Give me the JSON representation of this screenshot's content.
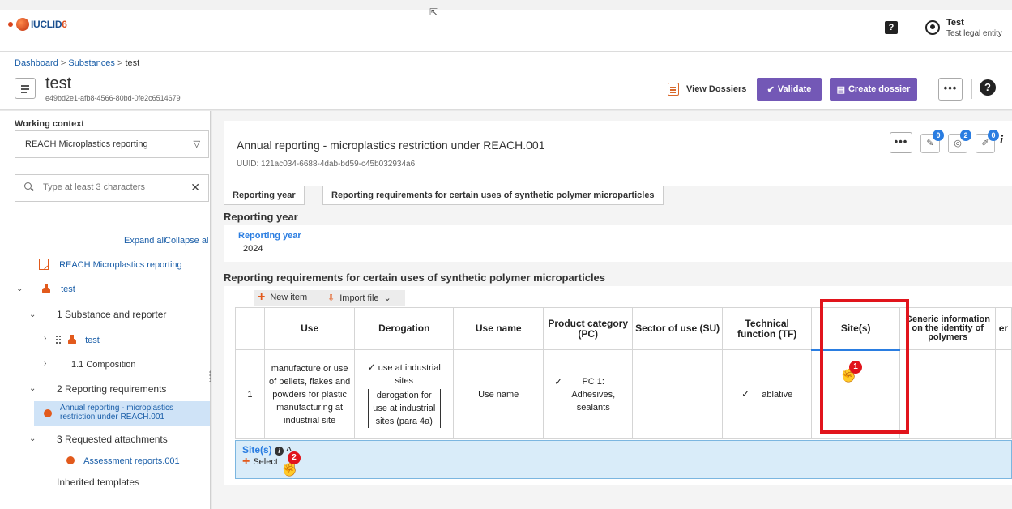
{
  "app": {
    "logo_text": "IUCLID",
    "logo_version": "6"
  },
  "topbar": {
    "user_name": "Test",
    "user_entity": "Test legal entity"
  },
  "breadcrumb": {
    "items": [
      "Dashboard",
      "Substances",
      "test"
    ],
    "separator": ">"
  },
  "entity": {
    "name": "test",
    "uuid": "e49bd2e1-afb8-4566-80bd-0fe2c6514679"
  },
  "header_actions": {
    "view_dossiers": "View Dossiers",
    "validate": "Validate",
    "create_dossier": "Create dossier",
    "more": "•••"
  },
  "working_context": {
    "label": "Working context",
    "value": "REACH Microplastics reporting"
  },
  "search": {
    "placeholder": "Type at least 3 characters"
  },
  "tree_controls": {
    "expand_all": "Expand all",
    "collapse_all": "Collapse al"
  },
  "tree": {
    "root_doc": "REACH Microplastics reporting",
    "substance": "test",
    "s1": "1 Substance and reporter",
    "s1_child": "test",
    "s1_1": "1.1 Composition",
    "s2": "2 Reporting requirements",
    "s2_child_line1": "Annual reporting - microplastics",
    "s2_child_line2": "restriction under REACH.001",
    "s3": "3 Requested attachments",
    "s3_child": "Assessment reports.001",
    "inherited": "Inherited templates"
  },
  "document": {
    "title": "Annual reporting - microplastics restriction under REACH.001",
    "uuid": "UUID: 121ac034-6688-4dab-bd59-c45b032934a6",
    "badges": [
      "0",
      "2",
      "0"
    ],
    "tabs": [
      "Reporting year",
      "Reporting requirements for certain uses of synthetic polymer microparticles"
    ]
  },
  "reporting_year": {
    "section": "Reporting year",
    "field_label": "Reporting year",
    "value": "2024"
  },
  "requirements": {
    "section": "Reporting requirements for certain uses of synthetic polymer microparticles",
    "new_item": "New item",
    "import_file": "Import file",
    "columns": [
      "",
      "Use",
      "Derogation",
      "Use name",
      "Product category (PC)",
      "Sector of use (SU)",
      "Technical function (TF)",
      "Site(s)",
      "Generic information on the identity of polymers",
      "er"
    ],
    "row": {
      "index": "1",
      "use": "manufacture or use of pellets, flakes and powders for plastic manufacturing at industrial site",
      "derogation_check": "use at industrial sites",
      "derogation_note": "derogation for use at industrial sites (para 4a)",
      "use_name": "Use name",
      "pc": "PC 1: Adhesives, sealants",
      "su": "",
      "tf": "ablative",
      "sites": "",
      "generic": ""
    },
    "site_panel": {
      "label": "Site(s)",
      "select": "Select"
    }
  },
  "annotations": {
    "badge1": "1",
    "badge2": "2"
  },
  "colors": {
    "accent": "#7358b6",
    "link": "#1a5ea8",
    "highlight": "#e1141c",
    "orange": "#e25a1c"
  }
}
